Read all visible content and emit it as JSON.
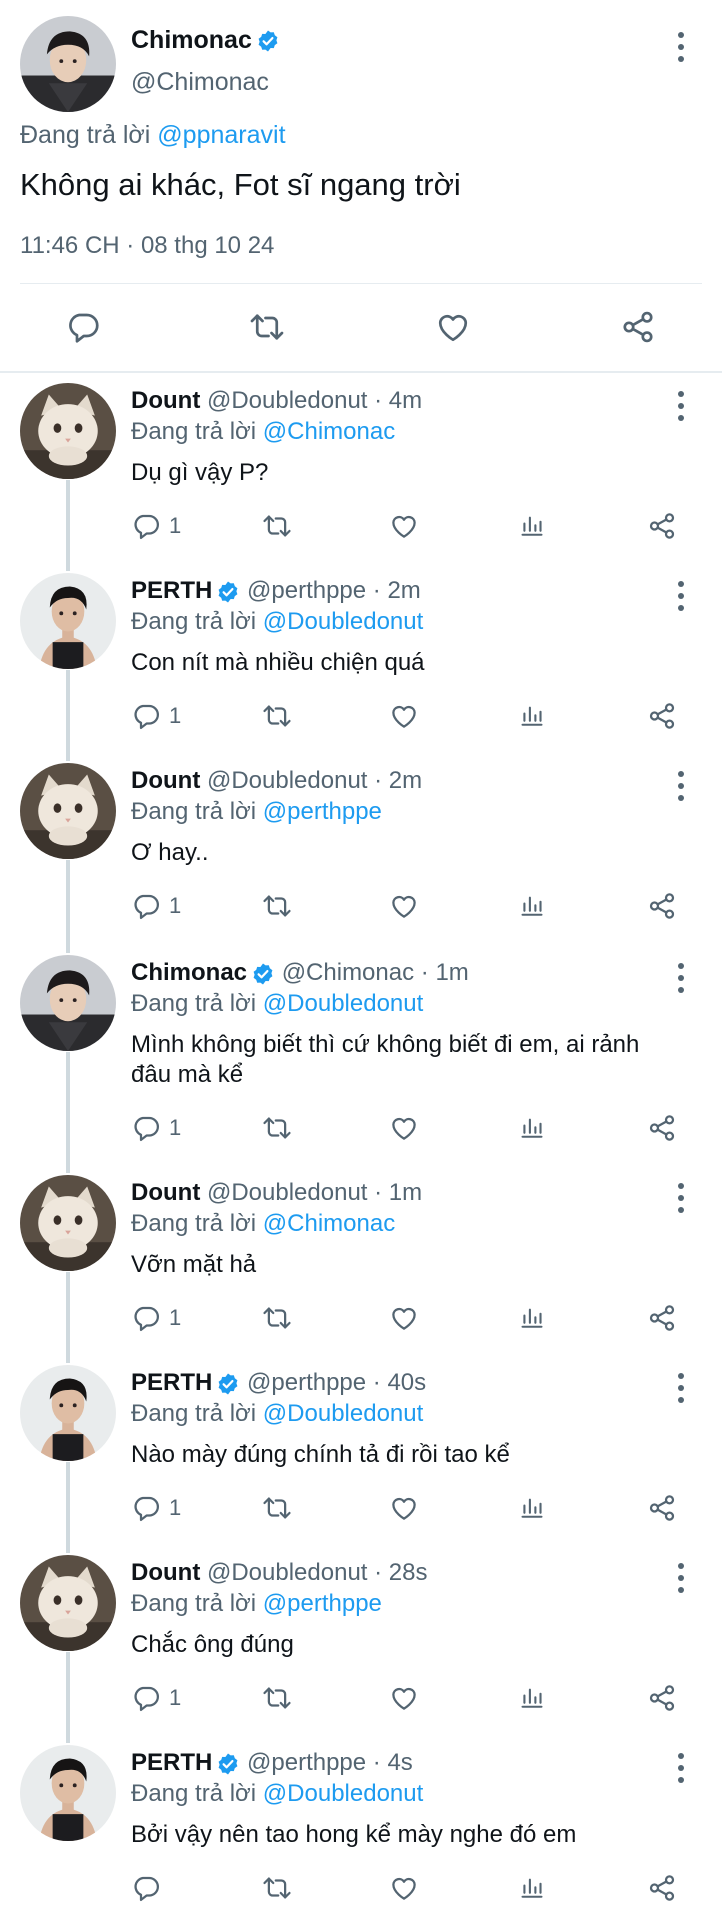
{
  "main_tweet": {
    "name": "Chimonac",
    "handle": "@Chimonac",
    "reply_prefix": "Đang trả lời",
    "reply_to": "@ppnaravit",
    "text": "Không ai khác, Fot sĩ ngang trời",
    "timestamp": "11:46 CH · 08 thg 10 24"
  },
  "colors": {
    "accent": "#1d9bf0",
    "muted": "#536471",
    "divider": "#e6ecf0"
  },
  "replies": [
    {
      "name": "Dount",
      "verified": false,
      "handle": "@Doubledonut",
      "time": "· 4m",
      "reply_prefix": "Đang trả lời",
      "reply_to": "@Chimonac",
      "text": "Dụ gì vậy P?",
      "reply_count": "1",
      "avatar": "cat"
    },
    {
      "name": "PERTH",
      "verified": true,
      "handle": "@perthppe",
      "time": "· 2m",
      "reply_prefix": "Đang trả lời",
      "reply_to": "@Doubledonut",
      "text": "Con nít mà nhiều chiện quá",
      "reply_count": "1",
      "avatar": "perth"
    },
    {
      "name": "Dount",
      "verified": false,
      "handle": "@Doubledonut",
      "time": "· 2m",
      "reply_prefix": "Đang trả lời",
      "reply_to": "@perthppe",
      "text": "Ơ hay..",
      "reply_count": "1",
      "avatar": "cat"
    },
    {
      "name": "Chimonac",
      "verified": true,
      "handle": "@Chimonac",
      "time": "· 1m",
      "reply_prefix": "Đang trả lời",
      "reply_to": "@Doubledonut",
      "text": "Mình không biết thì cứ không biết đi em, ai rảnh",
      "text2": "đâu mà kể",
      "reply_count": "1",
      "avatar": "chimonac"
    },
    {
      "name": "Dount",
      "verified": false,
      "handle": "@Doubledonut",
      "time": "· 1m",
      "reply_prefix": "Đang trả lời",
      "reply_to": "@Chimonac",
      "text": "Vỡn mặt hả",
      "reply_count": "1",
      "avatar": "cat"
    },
    {
      "name": "PERTH",
      "verified": true,
      "handle": "@perthppe",
      "time": "· 40s",
      "reply_prefix": "Đang trả lời",
      "reply_to": "@Doubledonut",
      "text": "Nào mày đúng chính tả đi rồi tao kể",
      "reply_count": "1",
      "avatar": "perth"
    },
    {
      "name": "Dount",
      "verified": false,
      "handle": "@Doubledonut",
      "time": "· 28s",
      "reply_prefix": "Đang trả lời",
      "reply_to": "@perthppe",
      "text": "Chắc ông đúng",
      "reply_count": "1",
      "avatar": "cat"
    },
    {
      "name": "PERTH",
      "verified": true,
      "handle": "@perthppe",
      "time": "· 4s",
      "reply_prefix": "Đang trả lời",
      "reply_to": "@Doubledonut",
      "text": "Bởi vậy nên tao hong kể mày nghe đó em",
      "reply_count": "",
      "avatar": "perth"
    }
  ],
  "icons": {
    "reply": "reply-icon",
    "retweet": "retweet-icon",
    "like": "heart-icon",
    "views": "views-icon",
    "share": "share-icon",
    "more": "more-icon",
    "verified": "verified-badge-icon"
  }
}
